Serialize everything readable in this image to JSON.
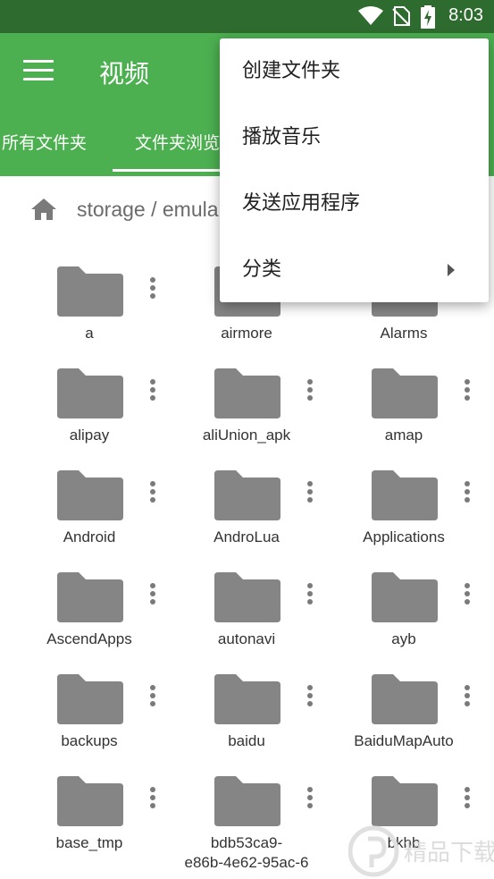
{
  "status_bar": {
    "time": "8:03",
    "icons": [
      "wifi-icon",
      "no-sim-icon",
      "battery-charging-icon"
    ]
  },
  "app_bar": {
    "title": "视频",
    "menu_icon": "hamburger-menu-icon"
  },
  "tabs": [
    {
      "label": "所有文件夹",
      "selected": false
    },
    {
      "label": "文件夹浏览",
      "selected": true
    }
  ],
  "breadcrumb": {
    "icon": "home-icon",
    "path": "storage / emula"
  },
  "popup_menu": {
    "items": [
      {
        "label": "创建文件夹",
        "has_submenu": false
      },
      {
        "label": "播放音乐",
        "has_submenu": false
      },
      {
        "label": "发送应用程序",
        "has_submenu": false
      },
      {
        "label": "分类",
        "has_submenu": true
      }
    ]
  },
  "folders": [
    {
      "name": "a"
    },
    {
      "name": "airmore"
    },
    {
      "name": "Alarms"
    },
    {
      "name": "alipay"
    },
    {
      "name": "aliUnion_apk"
    },
    {
      "name": "amap"
    },
    {
      "name": "Android"
    },
    {
      "name": "AndroLua"
    },
    {
      "name": "Applications"
    },
    {
      "name": "AscendApps"
    },
    {
      "name": "autonavi"
    },
    {
      "name": "ayb"
    },
    {
      "name": "backups"
    },
    {
      "name": "baidu"
    },
    {
      "name": "BaiduMapAuto"
    },
    {
      "name": "base_tmp"
    },
    {
      "name": "bdb53ca9-\ne86b-4e62-95ac-6"
    },
    {
      "name": "bkhb"
    }
  ],
  "watermark": {
    "text": "精品下载"
  },
  "colors": {
    "appbar": "#4caf50",
    "statusbar": "#2e6b2f",
    "folder": "#858585"
  }
}
